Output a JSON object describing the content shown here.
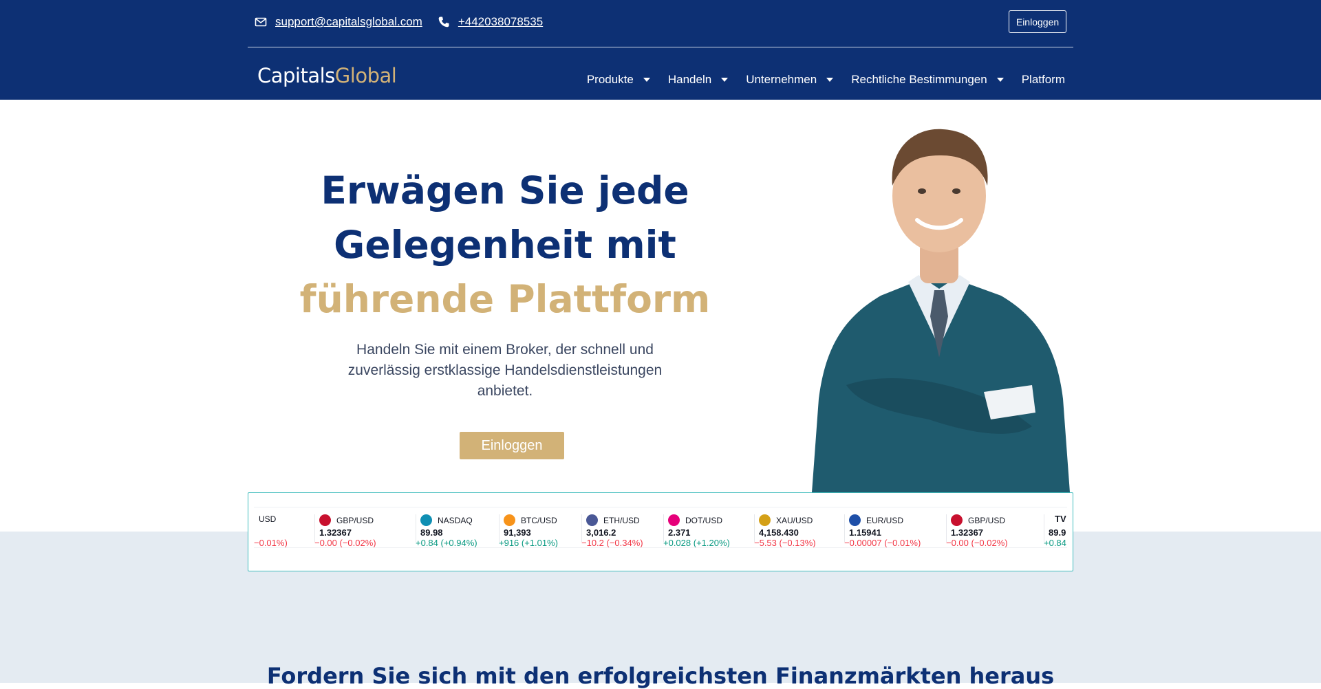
{
  "header": {
    "email": "support@capitalsglobal.com",
    "phone": "+442038078535",
    "login_label": "Einloggen",
    "logo_part1": "Capitals",
    "logo_part2": "Global"
  },
  "nav": {
    "items": [
      {
        "label": "Produkte",
        "dropdown": true
      },
      {
        "label": "Handeln",
        "dropdown": true
      },
      {
        "label": "Unternehmen",
        "dropdown": true
      },
      {
        "label": "Rechtliche Bestimmungen",
        "dropdown": true
      },
      {
        "label": "Platform",
        "dropdown": false
      }
    ]
  },
  "hero": {
    "headline_part1": "Erwägen Sie jede Gelegenheit mit ",
    "headline_highlight": "führende Plattform",
    "subtitle": "Handeln Sie mit einem Broker, der schnell und zuverlässig erstklassige Handelsdienstleistungen anbietet.",
    "cta_label": "Einloggen"
  },
  "ticker": {
    "items": [
      {
        "symbol": "USD",
        "price": "",
        "change": "−0.01%)",
        "direction": "neg",
        "icon_color": "#ffffff"
      },
      {
        "symbol": "GBP/USD",
        "price": "1.32367",
        "change": "−0.00 (−0.02%)",
        "direction": "neg",
        "icon_color": "#c8102e"
      },
      {
        "symbol": "NASDAQ",
        "price": "89.98",
        "change": "+0.84 (+0.94%)",
        "direction": "pos",
        "icon_color": "#0f8fb3"
      },
      {
        "symbol": "BTC/USD",
        "price": "91,393",
        "change": "+916 (+1.01%)",
        "direction": "pos",
        "icon_color": "#f7931a"
      },
      {
        "symbol": "ETH/USD",
        "price": "3,016.2",
        "change": "−10.2 (−0.34%)",
        "direction": "neg",
        "icon_color": "#4a5896"
      },
      {
        "symbol": "DOT/USD",
        "price": "2.371",
        "change": "+0.028 (+1.20%)",
        "direction": "pos",
        "icon_color": "#e6007a"
      },
      {
        "symbol": "XAU/USD",
        "price": "4,158.430",
        "change": "−5.53 (−0.13%)",
        "direction": "neg",
        "icon_color": "#d4a017"
      },
      {
        "symbol": "EUR/USD",
        "price": "1.15941",
        "change": "−0.00007 (−0.01%)",
        "direction": "neg",
        "icon_color": "#1e4fa8"
      },
      {
        "symbol": "GBP/USD",
        "price": "1.32367",
        "change": "−0.00 (−0.02%)",
        "direction": "neg",
        "icon_color": "#c8102e"
      },
      {
        "symbol": "",
        "price": "89.9",
        "change": "+0.84",
        "direction": "pos",
        "icon_color": "#ffffff"
      }
    ],
    "tv_icon": "TV"
  },
  "section": {
    "title": "Fordern Sie sich mit den erfolgreichsten Finanzmärkten heraus"
  }
}
